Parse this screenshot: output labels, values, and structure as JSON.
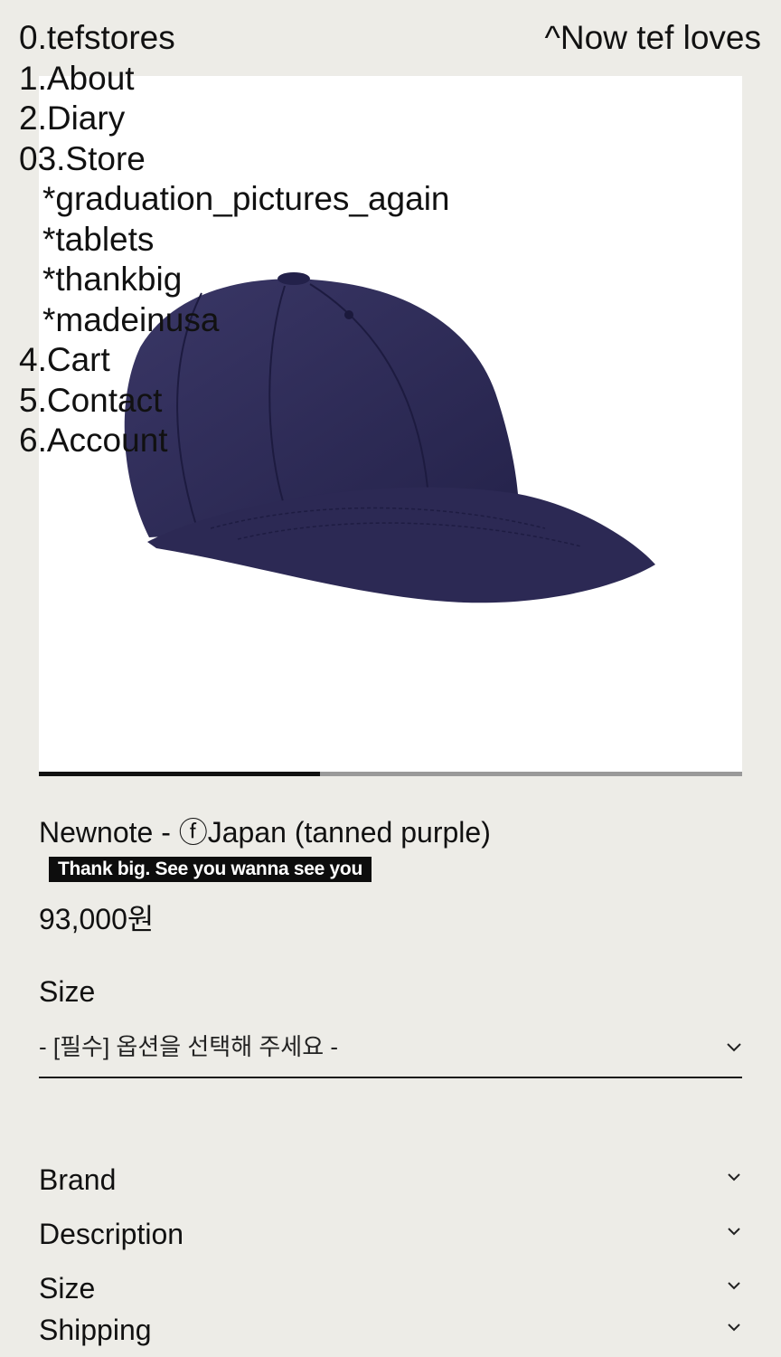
{
  "brand": {
    "home_link": "0.tefstores"
  },
  "nav": {
    "items": [
      {
        "label": "1.About"
      },
      {
        "label": "2.Diary"
      },
      {
        "label": "03.Store"
      }
    ],
    "store_sub": [
      {
        "label": "*graduation_pictures_again"
      },
      {
        "label": "*tablets"
      },
      {
        "label": "*thankbig"
      },
      {
        "label": "*madeinusa"
      }
    ],
    "items_after": [
      {
        "label": "4.Cart"
      },
      {
        "label": "5.Contact"
      },
      {
        "label": "6.Account"
      }
    ]
  },
  "header": {
    "now_link": "^Now tef loves"
  },
  "gallery": {
    "progress_fraction": 0.4
  },
  "product": {
    "title": "Newnote - ⓕJapan (tanned purple)",
    "tag": "Thank big. See you wanna see you",
    "price": "93,000원"
  },
  "options": {
    "size_label": "Size",
    "size_placeholder": "- [필수] 옵션을 선택해 주세요 -"
  },
  "accordions": [
    {
      "label": "Brand"
    },
    {
      "label": "Description"
    },
    {
      "label": "Size"
    },
    {
      "label": "Shipping"
    }
  ],
  "colors": {
    "background": "#edece7",
    "cap": "#2e2b55",
    "text": "#111111"
  },
  "icons": {
    "chevron": "chevron-down-icon"
  }
}
